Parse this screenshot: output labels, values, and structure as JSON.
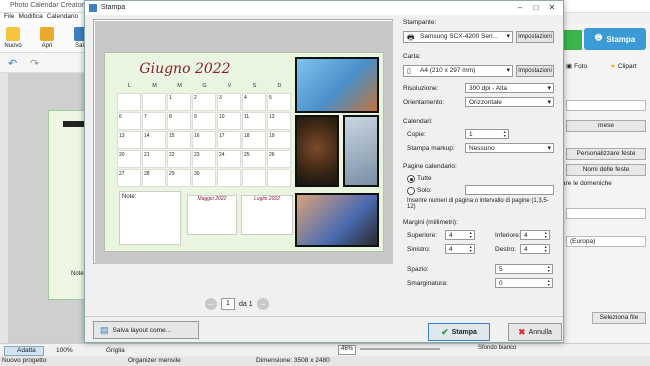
{
  "app": {
    "title": "Photo Calendar Creator",
    "menu": [
      "File",
      "Modifica",
      "Calendario"
    ],
    "ribbon": [
      "Nuovo",
      "Apri",
      "Salv"
    ],
    "bottom": {
      "fit": "Adatta",
      "zoom": "100%",
      "grid": "Griglia",
      "status_left": "Nuovo progetto",
      "status_mid": "Organizer mensile",
      "dimension": "Dimensione: 3508 x 2480",
      "zoom_pct": "46%"
    },
    "right": {
      "print_btn": "Stampa",
      "tab_photo": "Foto",
      "tab_clipart": "Clipart",
      "mese": "mese",
      "customize": "Personalizzare feste",
      "holiday_names": "Nomi delle feste",
      "sundays": "are le domeniche",
      "region": "(Europa)",
      "select": "Seleziona file",
      "white_bg": "Sfondo bianco"
    },
    "preview_notes": "Note"
  },
  "dialog": {
    "title": "Stampa",
    "printer": {
      "label": "Stampante:",
      "value": "Samsung SCX-4200 Seri...",
      "settings": "Impostazioni"
    },
    "paper": {
      "label": "Carta:",
      "value": "A4 (210 x 297 mm)",
      "settings": "Impostazioni"
    },
    "resolution": {
      "label": "Risoluzione:",
      "value": "300 dpi - Alta"
    },
    "orientation": {
      "label": "Orientamento:",
      "value": "Orizzontale"
    },
    "calendars": {
      "label": "Calendari:",
      "copies_label": "Copie:",
      "copies": "1",
      "markup_label": "Stampa markup:",
      "markup": "Nessuno"
    },
    "pages": {
      "label": "Pagine calendario:",
      "all": "Tutte",
      "only": "Solo:",
      "hint": "Inserire numeri di pagina o intervallo di pagine (1,3,5-12)"
    },
    "margins": {
      "label": "Margini (millimetri):",
      "top_label": "Superiore:",
      "top": "4",
      "bottom_label": "Inferiore:",
      "bottom": "4",
      "left_label": "Sinistro:",
      "left": "4",
      "right_label": "Destro:",
      "right": "4"
    },
    "spacing": {
      "label": "Spazio:",
      "value": "5"
    },
    "bleed": {
      "label": "Smarginatura:",
      "value": "0"
    },
    "pager": {
      "page": "1",
      "of": "da 1"
    },
    "save_layout": "Salva layout come...",
    "print": "Stampa",
    "cancel": "Annulla"
  },
  "preview": {
    "title": "Giugno 2022",
    "days": [
      "L",
      "M",
      "M",
      "G",
      "V",
      "S",
      "D"
    ],
    "weeks": [
      [
        "",
        "",
        "1",
        "2",
        "3",
        "4",
        "5"
      ],
      [
        "6",
        "7",
        "8",
        "9",
        "10",
        "11",
        "12"
      ],
      [
        "13",
        "14",
        "15",
        "16",
        "17",
        "18",
        "19"
      ],
      [
        "20",
        "21",
        "22",
        "23",
        "24",
        "25",
        "26"
      ],
      [
        "27",
        "28",
        "29",
        "30",
        "",
        "",
        ""
      ]
    ],
    "notes": "Note:",
    "prev_month": "Maggio 2022",
    "next_month": "Luglio 2022"
  },
  "colors": {
    "accent": "#8b1c2a",
    "green": "#3bb54a",
    "blue": "#3b9bd6"
  }
}
